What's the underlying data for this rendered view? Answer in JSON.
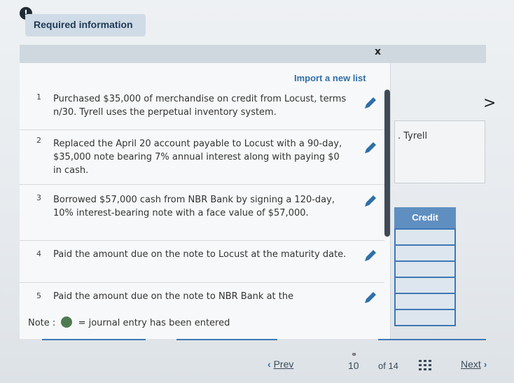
{
  "header": {
    "alert_glyph": "!",
    "title": "Required information"
  },
  "popup": {
    "close_glyph": "x",
    "import_label": "Import a new list",
    "items": [
      {
        "num": "1",
        "text": "Purchased $35,000 of merchandise on credit from Locust, terms n/30. Tyrell uses the perpetual inventory system."
      },
      {
        "num": "2",
        "text": "Replaced the April 20 account payable to Locust with a 90-day, $35,000 note bearing 7% annual interest along with paying $0 in cash."
      },
      {
        "num": "3",
        "text": "Borrowed $57,000 cash from NBR Bank by signing a 120-day, 10% interest-bearing note with a face value of $57,000."
      },
      {
        "num": "4",
        "text": "Paid the amount due on the note to Locust at the maturity date."
      },
      {
        "num": "5",
        "text": "Paid the amount due on the note to NBR Bank at the"
      }
    ],
    "note_prefix": "Note :",
    "note_suffix": "= journal entry has been entered",
    "entered_color": "#4e7a52"
  },
  "background": {
    "chevron": ">",
    "name_text": ". Tyrell",
    "credit_header": "Credit"
  },
  "pager": {
    "prev_label": "Prev",
    "current_page": "10",
    "of_total": "of 14",
    "next_label": "Next"
  },
  "colors": {
    "accent": "#2f6fa8",
    "credit_blue": "#3f78b4"
  }
}
